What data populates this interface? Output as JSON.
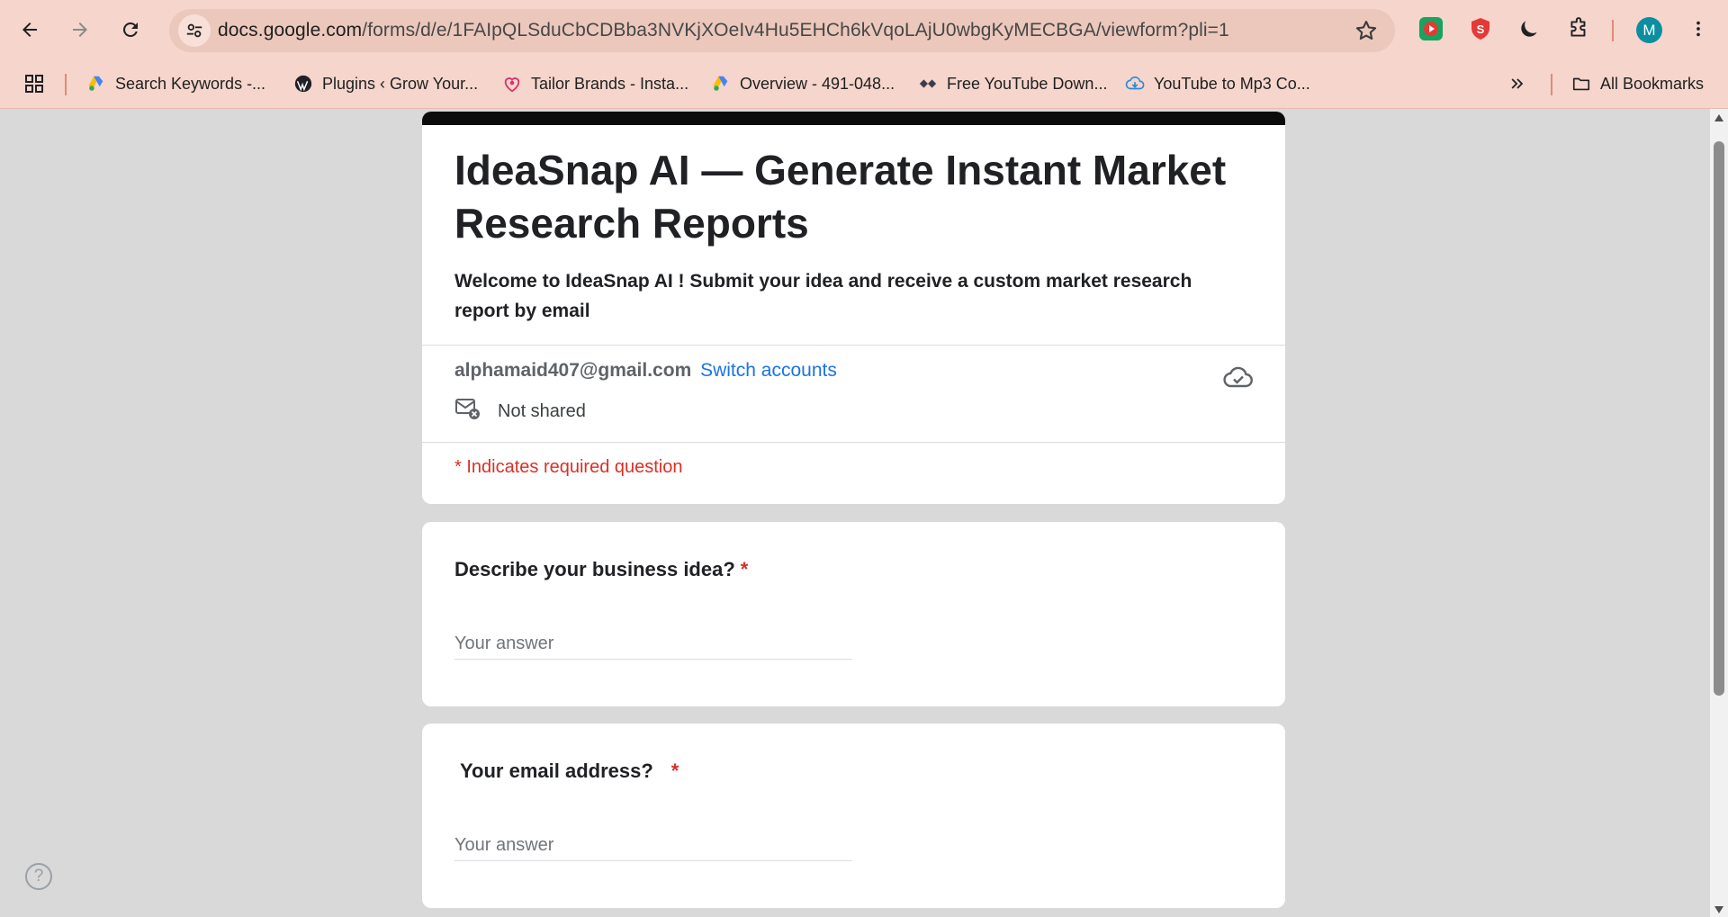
{
  "browser": {
    "url_host": "docs.google.com",
    "url_path": "/forms/d/e/1FAIpQLSduCbCDBba3NVKjXOeIv4Hu5EHCh6kVqoLAjU0wbgKyMECBGA/viewform?pli=1",
    "profile_initial": "M",
    "bookmarks": [
      {
        "label": "Search Keywords -...",
        "icon": "google-ads-icon"
      },
      {
        "label": "Plugins ‹ Grow Your...",
        "icon": "wordpress-icon"
      },
      {
        "label": "Tailor Brands - Insta...",
        "icon": "tailor-brands-icon"
      },
      {
        "label": "Overview - 491-048...",
        "icon": "google-ads-icon"
      },
      {
        "label": "Free YouTube Down...",
        "icon": "downloader-icon"
      },
      {
        "label": "YouTube to Mp3 Co...",
        "icon": "cloud-download-icon"
      }
    ],
    "all_bookmarks_label": "All Bookmarks"
  },
  "form": {
    "title": "IdeaSnap AI — Generate Instant Market Research Reports",
    "description": "Welcome to IdeaSnap AI ! Submit your idea and receive a custom market research report by email",
    "account_email": "alphamaid407@gmail.com",
    "switch_accounts": "Switch accounts",
    "not_shared": "Not shared",
    "required_note": "* Indicates required question",
    "questions": [
      {
        "title": "Describe your business idea?",
        "required_mark": "*",
        "placeholder": "Your answer"
      },
      {
        "title": "Your email address?",
        "required_mark": "*",
        "placeholder": "Your answer"
      }
    ],
    "help_symbol": "?"
  },
  "colors": {
    "chrome_bg": "#f5d5cc",
    "page_bg": "#d9d9d9",
    "header_band": "#0b0b0b",
    "link": "#1a73e8",
    "required": "#d93025"
  }
}
